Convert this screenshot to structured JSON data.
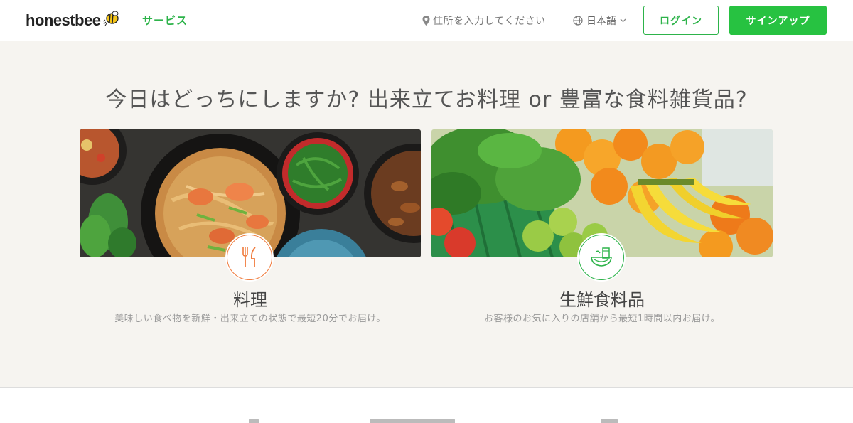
{
  "header": {
    "logo_text": "honestbee",
    "service_label": "サービス",
    "address_placeholder": "住所を入力してください",
    "language_label": "日本語",
    "login_label": "ログイン",
    "signup_label": "サインアップ"
  },
  "hero": {
    "title": "今日はどっちにしますか? 出来立てお料理 or 豊富な食料雑貨品?",
    "cards": [
      {
        "title": "料理",
        "description": "美味しい食べ物を新鮮・出来立ての状態で最短20分でお届け。",
        "icon": "fork-knife-icon",
        "accent": "#f07b3c"
      },
      {
        "title": "生鮮食料品",
        "description": "お客様のお気に入りの店舗から最短1時間以内お届け。",
        "icon": "grocery-bowl-icon",
        "accent": "#2db34a"
      }
    ]
  },
  "colors": {
    "brand_green": "#27c241",
    "food_orange": "#f07b3c",
    "hero_bg": "#f6f4f0"
  }
}
